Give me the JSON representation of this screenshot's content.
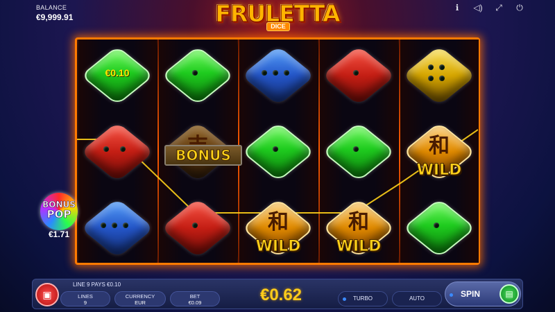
{
  "header": {
    "balance_label": "BALANCE",
    "balance_value": "€9,999.91",
    "logo_text": "FRULETTA",
    "logo_sub": "DICE",
    "icons": [
      "info-icon",
      "sound-icon",
      "fullscreen-icon",
      "power-icon"
    ]
  },
  "reels": [
    [
      {
        "type": "green",
        "label": "€0.10"
      },
      {
        "type": "red",
        "pips": 2
      },
      {
        "type": "blue",
        "pips": 3
      }
    ],
    [
      {
        "type": "green",
        "pips": 1
      },
      {
        "type": "bonus",
        "label": "BONUS"
      },
      {
        "type": "red",
        "pips": 1
      }
    ],
    [
      {
        "type": "blue",
        "pips": 3
      },
      {
        "type": "green",
        "pips": 1
      },
      {
        "type": "wild",
        "label": "WILD"
      }
    ],
    [
      {
        "type": "red",
        "pips": 1
      },
      {
        "type": "green",
        "pips": 1
      },
      {
        "type": "wild",
        "label": "WILD"
      }
    ],
    [
      {
        "type": "yellow",
        "pips": 4
      },
      {
        "type": "wild",
        "label": "WILD"
      },
      {
        "type": "green",
        "pips": 1
      }
    ]
  ],
  "bonus_pop": {
    "line1": "BONUS",
    "line2": "POP",
    "amount": "€1.71"
  },
  "bottom_bar": {
    "line_info": "LINE 9 PAYS €0.10",
    "lines_label": "LINES",
    "lines_value": "9",
    "currency_label": "CURRENCY",
    "currency_value": "EUR",
    "bet_label": "BET",
    "bet_value": "€0.09",
    "win_amount": "€0.62",
    "turbo_label": "TURBO",
    "auto_label": "AUTO",
    "spin_label": "SPIN"
  },
  "colors": {
    "frame": "#ff7a00",
    "win_line": "#ffd21a",
    "accent": "#ffcc1a"
  }
}
